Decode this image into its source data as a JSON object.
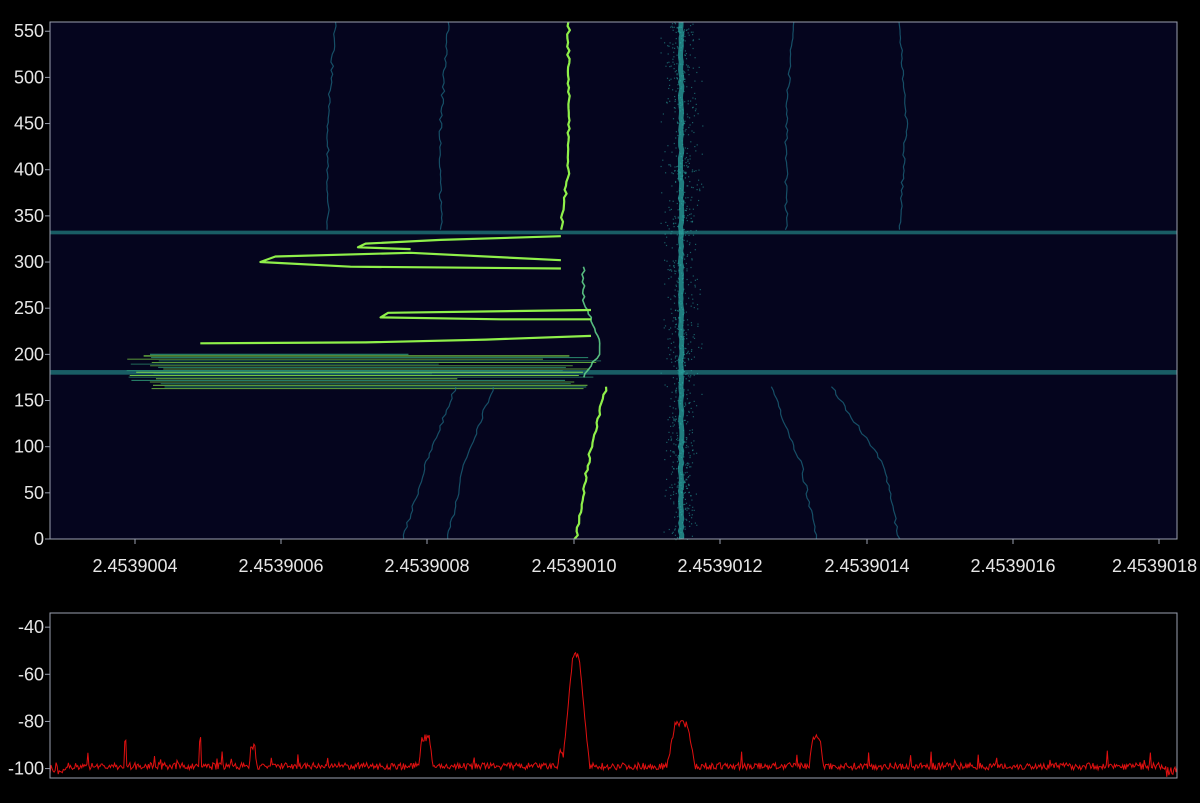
{
  "colors": {
    "background": "#000000",
    "plot_background": "#05051e",
    "frame": "#9aa0b0",
    "spectrum_line": "#e01010",
    "carrier_bright": "#8ff04a",
    "carrier_dim": "#2aa6a0"
  },
  "chart_data": [
    {
      "type": "heatmap",
      "title": "",
      "xlabel": "",
      "ylabel": "",
      "x_ticks": [
        2.4539004,
        2.4539006,
        2.4539008,
        2.453901,
        2.4539012,
        2.4539014,
        2.4539016,
        2.4539018
      ],
      "x_tick_labels": [
        "2.4539004",
        "2.4539006",
        "2.4539008",
        "2.4539010",
        "2.4539012",
        "2.4539014",
        "2.4539016",
        "2.4539018"
      ],
      "xlim": [
        2.4539002,
        2.4539017
      ],
      "y_ticks": [
        0,
        50,
        100,
        150,
        200,
        250,
        300,
        350,
        400,
        450,
        500,
        550
      ],
      "y_tick_labels": [
        "0",
        "50",
        "100",
        "150",
        "200",
        "250",
        "300",
        "350",
        "400",
        "450",
        "500",
        "550"
      ],
      "ylim": [
        0,
        560
      ],
      "colormap": [
        "#05051e",
        "#1f6f86",
        "#2aa6a0",
        "#8ff04a"
      ],
      "grid": false,
      "features": [
        {
          "kind": "carrier_track",
          "intensity": "bright",
          "points": [
            [
              2.4539009,
              0
            ],
            [
              2.45390091,
              50
            ],
            [
              2.45390092,
              100
            ],
            [
              2.45390094,
              165
            ]
          ]
        },
        {
          "kind": "carrier_track",
          "intensity": "bright",
          "points": [
            [
              2.45390088,
              335
            ],
            [
              2.45390089,
              400
            ],
            [
              2.45390089,
              480
            ],
            [
              2.45390089,
              560
            ]
          ]
        },
        {
          "kind": "carrier_track",
          "intensity": "medium",
          "points": [
            [
              2.45390091,
              175
            ],
            [
              2.45390093,
              200
            ],
            [
              2.45390093,
              220
            ],
            [
              2.45390092,
              240
            ],
            [
              2.45390091,
              255
            ],
            [
              2.45390091,
              270
            ],
            [
              2.45390091,
              295
            ]
          ]
        },
        {
          "kind": "carrier_track",
          "intensity": "dim",
          "points": [
            [
              2.45390104,
              0
            ],
            [
              2.45390104,
              560
            ]
          ]
        },
        {
          "kind": "carrier_track",
          "intensity": "faint",
          "points": [
            [
              2.45390073,
              0
            ],
            [
              2.45390075,
              80
            ],
            [
              2.45390079,
              165
            ]
          ]
        },
        {
          "kind": "carrier_track",
          "intensity": "faint",
          "points": [
            [
              2.45390133,
              0
            ],
            [
              2.45390131,
              80
            ],
            [
              2.45390124,
              165
            ]
          ]
        },
        {
          "kind": "carrier_track",
          "intensity": "faint",
          "points": [
            [
              2.45390067,
              0
            ],
            [
              2.4539007,
              80
            ],
            [
              2.45390074,
              165
            ]
          ]
        },
        {
          "kind": "carrier_track",
          "intensity": "faint",
          "points": [
            [
              2.45390122,
              0
            ],
            [
              2.4539012,
              80
            ],
            [
              2.45390116,
              165
            ]
          ]
        },
        {
          "kind": "carrier_track",
          "intensity": "faint",
          "points": [
            [
              2.45390072,
              335
            ],
            [
              2.45390072,
              450
            ],
            [
              2.45390073,
              560
            ]
          ]
        },
        {
          "kind": "carrier_track",
          "intensity": "faint",
          "points": [
            [
              2.45390133,
              335
            ],
            [
              2.45390134,
              450
            ],
            [
              2.45390133,
              560
            ]
          ]
        },
        {
          "kind": "carrier_track",
          "intensity": "faint",
          "points": [
            [
              2.45390057,
              335
            ],
            [
              2.45390057,
              460
            ],
            [
              2.45390058,
              560
            ]
          ]
        },
        {
          "kind": "carrier_track",
          "intensity": "faint",
          "points": [
            [
              2.45390118,
              335
            ],
            [
              2.45390118,
              460
            ],
            [
              2.45390119,
              560
            ]
          ]
        },
        {
          "kind": "sweep",
          "intensity": "bright",
          "points": [
            [
              2.45390088,
              302
            ],
            [
              2.45390068,
              310
            ],
            [
              2.4539005,
              306
            ],
            [
              2.45390048,
              300
            ],
            [
              2.4539006,
              295
            ],
            [
              2.45390088,
              293
            ]
          ]
        },
        {
          "kind": "sweep",
          "intensity": "bright",
          "points": [
            [
              2.45390092,
              248
            ],
            [
              2.45390065,
              245
            ],
            [
              2.45390064,
              240
            ],
            [
              2.4539008,
              238
            ],
            [
              2.45390092,
              238
            ]
          ]
        },
        {
          "kind": "sweep",
          "intensity": "bright",
          "points": [
            [
              2.45390088,
              328
            ],
            [
              2.45390072,
              324
            ],
            [
              2.45390062,
              320
            ],
            [
              2.45390061,
              316
            ],
            [
              2.45390068,
              314
            ]
          ]
        },
        {
          "kind": "sweep",
          "intensity": "bright",
          "points": [
            [
              2.45390092,
              220
            ],
            [
              2.45390078,
              216
            ],
            [
              2.45390062,
              213
            ],
            [
              2.4539004,
              212
            ]
          ]
        },
        {
          "kind": "band",
          "intensity": "medium",
          "x_range": [
            2.4539002,
            2.4539017
          ],
          "y_range": [
            178,
            183
          ]
        },
        {
          "kind": "band",
          "intensity": "medium",
          "x_range": [
            2.4539002,
            2.4539017
          ],
          "y_range": [
            330,
            334
          ]
        },
        {
          "kind": "band",
          "intensity": "bright",
          "x_range": [
            2.4539003,
            2.45390094
          ],
          "y_range": [
            163,
            200
          ]
        }
      ]
    },
    {
      "type": "line",
      "title": "",
      "xlabel": "",
      "ylabel": "",
      "y_ticks": [
        -40,
        -60,
        -80,
        -100
      ],
      "y_tick_labels": [
        "-40",
        "-60",
        "-80",
        "-100"
      ],
      "ylim": [
        -104,
        -34
      ],
      "xlim": [
        2.4539002,
        2.4539017
      ],
      "grid": false,
      "noise_floor": -99,
      "series": [
        {
          "peaks": [
            {
              "x": 2.4539009,
              "y": -52,
              "width": 4e-09
            },
            {
              "x": 2.4539007,
              "y": -87,
              "width": 5e-09
            },
            {
              "x": 2.45390122,
              "y": -87,
              "width": 5e-09
            },
            {
              "x": 2.45390104,
              "y": -81,
              "width": 8e-09
            },
            {
              "x": 2.45390088,
              "y": -93,
              "width": 2e-09
            },
            {
              "x": 2.45390047,
              "y": -91,
              "width": 3e-09
            },
            {
              "x": 2.4539003,
              "y": -89,
              "width": 1e-09
            },
            {
              "x": 2.4539004,
              "y": -88,
              "width": 1e-09
            }
          ]
        }
      ]
    }
  ]
}
